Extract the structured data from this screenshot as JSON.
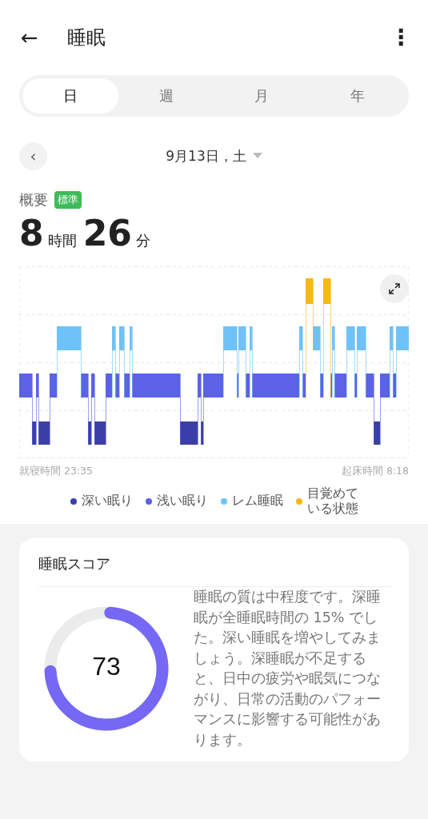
{
  "header": {
    "back": "←",
    "title": "睡眠",
    "menu": "⋮"
  },
  "tabs": [
    {
      "label": "日",
      "selected": true
    },
    {
      "label": "週",
      "selected": false
    },
    {
      "label": "月",
      "selected": false
    },
    {
      "label": "年",
      "selected": false
    }
  ],
  "date_nav": {
    "prev": "‹",
    "date": "9月13日，土"
  },
  "summary": {
    "label": "概要",
    "badge": "標準",
    "hours": "8",
    "hours_unit": "時間",
    "minutes": "26",
    "minutes_unit": "分"
  },
  "timeline": {
    "bedtime": "就寝時間 23:35",
    "wake_time": "起床時間 8:18"
  },
  "legend": [
    {
      "label": "深い眠り",
      "color": "#3a3fa8"
    },
    {
      "label": "浅い眠り",
      "color": "#5b62e6"
    },
    {
      "label": "レム睡眠",
      "color": "#6ec2f7"
    },
    {
      "label": "目覚めている状態",
      "color": "#f7b718"
    }
  ],
  "score_card": {
    "title": "睡眠スコア",
    "score": "73",
    "level": 0.73,
    "text": "睡眠の質は中程度です。深睡眠が全睡眠時間の 15% でした。深い睡眠を増やしてみましょう。深睡眠が不足すると、日中の疲労や眠気につながり、日常の活動のパフォーマンスに影響する可能性があります。"
  }
}
